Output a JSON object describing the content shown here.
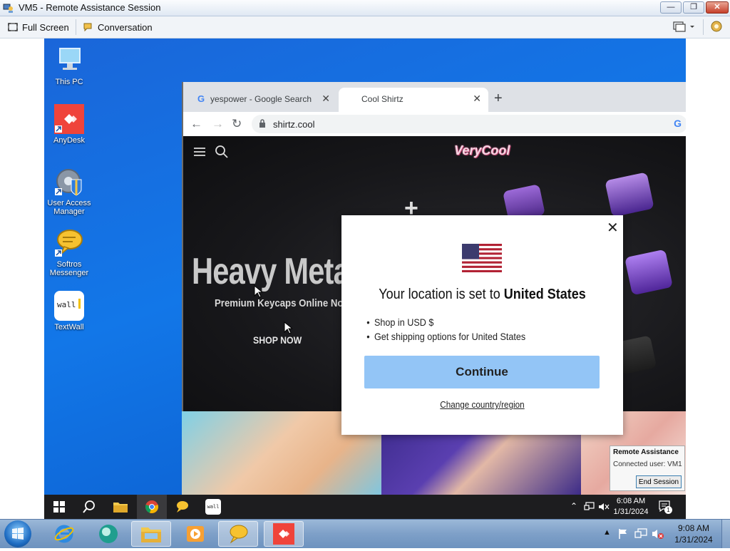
{
  "window": {
    "title": "VM5 - Remote Assistance Session",
    "min_label": "—",
    "max_label": "❐",
    "close_label": "✕"
  },
  "toolbar": {
    "full_screen_label": "Full Screen",
    "conversation_label": "Conversation"
  },
  "desktop": {
    "icons": [
      {
        "label": "This PC",
        "icon": "computer-icon"
      },
      {
        "label": "AnyDesk",
        "icon": "anydesk-icon"
      },
      {
        "label": "User Access Manager",
        "icon": "user-access-manager-icon"
      },
      {
        "label": "Softros Messenger",
        "icon": "softros-messenger-icon"
      },
      {
        "label": "TextWall",
        "icon": "textwall-icon"
      }
    ],
    "textwall_icon_text": "wall"
  },
  "browser": {
    "tabs": [
      {
        "title": "yespower - Google Search",
        "favicon": "G"
      },
      {
        "title": "Cool Shirtz",
        "favicon": ""
      }
    ],
    "new_tab_label": "+",
    "url": "shirtz.cool",
    "google_icon_text": "G",
    "page": {
      "logo_text": "VeryCool",
      "hero_title": "Heavy Metal",
      "hero_subtitle": "Premium Keycaps Online Now.",
      "shop_now": "SHOP NOW",
      "keycap_symbol": "+"
    }
  },
  "modal": {
    "title_prefix": "Your location is set to ",
    "title_country": "United States",
    "bullets": [
      "Shop in USD $",
      "Get shipping options for United States"
    ],
    "continue_label": "Continue",
    "change_link": "Change country/region",
    "close_label": "✕"
  },
  "ra_popup": {
    "heading": "Remote Assistance",
    "connected": "Connected user: VM1",
    "end_session_label": "End Session"
  },
  "remote_taskbar": {
    "time": "6:08 AM",
    "date": "1/31/2024",
    "notification_count": "1",
    "textwall_label": "wall"
  },
  "local_taskbar": {
    "time": "9:08 AM",
    "date": "1/31/2024"
  },
  "colors": {
    "continue_button": "#93c5f6",
    "desktop_blue": "#1277e8",
    "anydesk_red": "#ef443b"
  }
}
